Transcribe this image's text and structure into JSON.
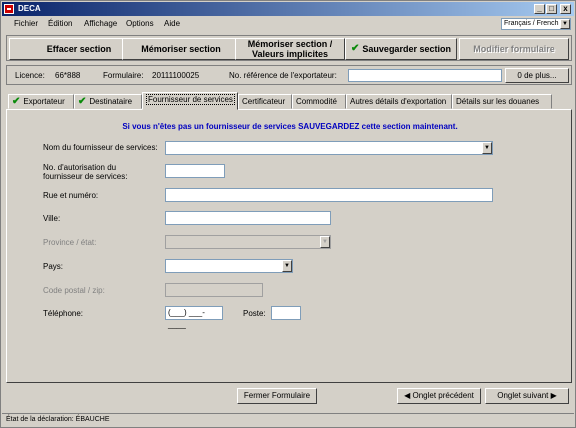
{
  "window": {
    "title": "DECA",
    "controls": [
      "_",
      "□",
      "x"
    ]
  },
  "menu": {
    "items": [
      "Fichier",
      "Édition",
      "Affichage",
      "Options",
      "Aide"
    ],
    "language": "Français / French"
  },
  "toolbar": {
    "clear": "Effacer section",
    "memorize": "Mémoriser section",
    "memorize_defaults_line1": "Mémoriser section /",
    "memorize_defaults_line2": "Valeurs implicites",
    "save": "Sauvegarder section",
    "modify": "Modifier formulaire"
  },
  "info": {
    "licence_label": "Licence:",
    "licence_value": "66*888",
    "form_label": "Formulaire:",
    "form_value": "20111100025",
    "ref_label": "No. référence de l'exportateur:",
    "ref_value": "",
    "more_button": "0 de plus..."
  },
  "tabs": [
    {
      "label": "Exportateur",
      "checked": true
    },
    {
      "label": "Destinataire",
      "checked": true
    },
    {
      "label": "Fournisseur de services",
      "checked": false,
      "active": true
    },
    {
      "label": "Certificateur",
      "checked": false
    },
    {
      "label": "Commodité",
      "checked": false
    },
    {
      "label": "Autres détails d'exportation",
      "checked": false
    },
    {
      "label": "Détails sur les douanes",
      "checked": false
    }
  ],
  "form": {
    "notice": "Si vous n'êtes pas un fournisseur de services SAUVEGARDEZ cette section maintenant.",
    "provider_name_label": "Nom du fournisseur de services:",
    "provider_name_value": "",
    "auth_no_label_line1": "No. d'autorisation du",
    "auth_no_label_line2": "fournisseur de services:",
    "auth_no_value": "",
    "street_label": "Rue et numéro:",
    "street_value": "",
    "city_label": "Ville:",
    "city_value": "",
    "province_label": "Province / état:",
    "province_value": "",
    "country_label": "Pays:",
    "country_value": "",
    "postal_label": "Code postal / zip:",
    "postal_value": "",
    "phone_label": "Téléphone:",
    "phone_value": "(___) ___-____",
    "ext_label": "Poste:",
    "ext_value": ""
  },
  "bottom": {
    "close": "Fermer Formulaire",
    "prev": "Onglet précédent",
    "next": "Onglet suivant"
  },
  "status": {
    "text": "État de la déclaration:  ÉBAUCHE"
  },
  "colors": {
    "titlebar": "#0a246a",
    "notice": "#0000c0",
    "check": "#0a8a0a"
  }
}
